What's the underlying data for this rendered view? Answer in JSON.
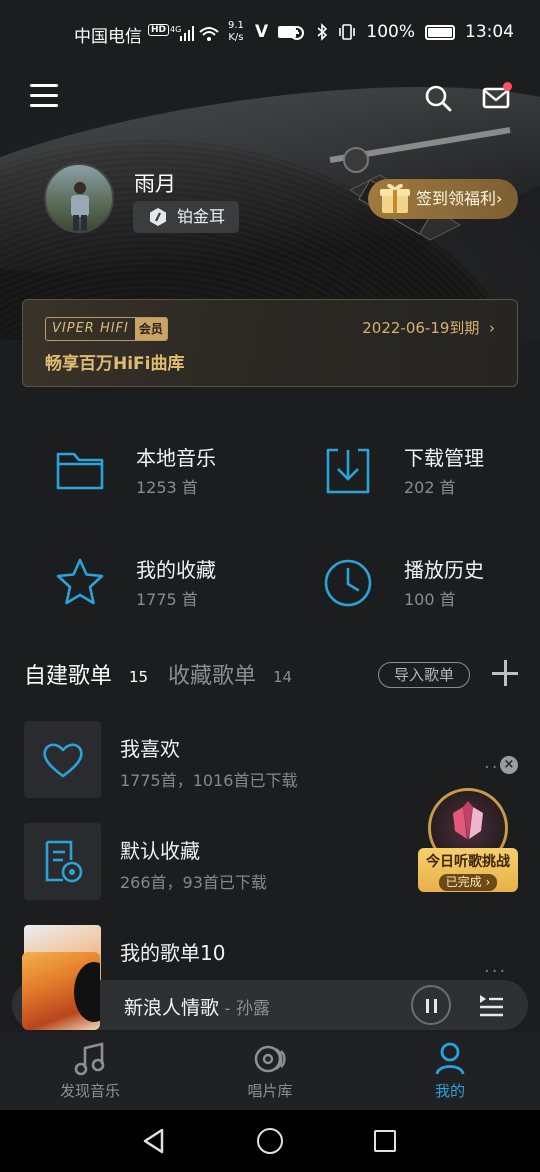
{
  "status_bar": {
    "carrier": "中国电信",
    "hd": "HD",
    "network": "4G",
    "speed_value": "9.1",
    "speed_unit": "K/s",
    "battery": "100%",
    "time": "13:04"
  },
  "profile": {
    "username": "雨月",
    "level": "铂金耳",
    "checkin_label": "签到领福利"
  },
  "vip": {
    "logo_text": "VIPER HIFI",
    "logo_tag": "会员",
    "slogan": "畅享百万HiFi曲库",
    "expire": "2022-06-19到期"
  },
  "grid": [
    {
      "title": "本地音乐",
      "count": "1253 首",
      "icon": "folder-icon"
    },
    {
      "title": "下载管理",
      "count": "202 首",
      "icon": "download-icon"
    },
    {
      "title": "我的收藏",
      "count": "1775 首",
      "icon": "star-icon"
    },
    {
      "title": "播放历史",
      "count": "100 首",
      "icon": "clock-icon"
    }
  ],
  "playlist_tabs": {
    "own_label": "自建歌单",
    "own_count": "15",
    "fav_label": "收藏歌单",
    "fav_count": "14",
    "import_label": "导入歌单"
  },
  "playlists": [
    {
      "title": "我喜欢",
      "sub": "1775首，1016首已下载",
      "icon": "heart-icon"
    },
    {
      "title": "默认收藏",
      "sub": "266首，93首已下载",
      "icon": "document-icon"
    },
    {
      "title": "我的歌单10",
      "sub": ""
    }
  ],
  "challenge": {
    "title": "今日听歌挑战",
    "status": "已完成",
    "close": "×"
  },
  "now_playing": {
    "song": "新浪人情歌",
    "artist": " - 孙露"
  },
  "bottom_tabs": [
    {
      "label": "发现音乐",
      "icon": "music-note-icon"
    },
    {
      "label": "唱片库",
      "icon": "disc-icon"
    },
    {
      "label": "我的",
      "icon": "person-icon",
      "active": true
    }
  ],
  "colors": {
    "accent": "#2aa3d8",
    "gold": "#e0bc73",
    "background": "#1c1d1f"
  }
}
